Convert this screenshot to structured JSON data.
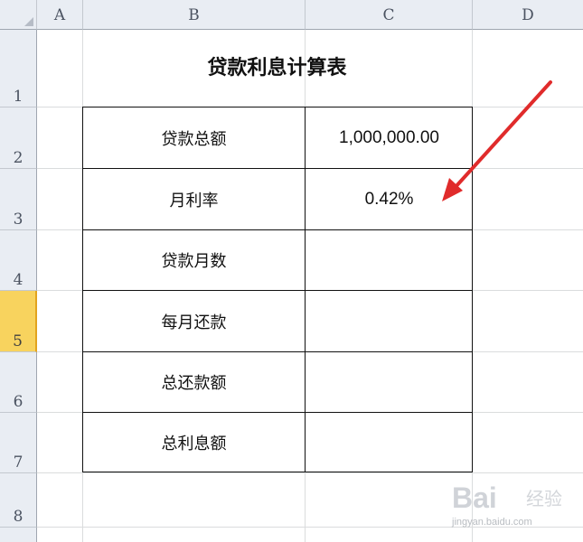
{
  "columns": [
    "A",
    "B",
    "C",
    "D"
  ],
  "rows": [
    "1",
    "2",
    "3",
    "4",
    "5",
    "6",
    "7",
    "8"
  ],
  "selected_row": "5",
  "sheet": {
    "title": "贷款利息计算表",
    "table": [
      {
        "label": "贷款总额",
        "value": "1,000,000.00"
      },
      {
        "label": "月利率",
        "value": "0.42%"
      },
      {
        "label": "贷款月数",
        "value": ""
      },
      {
        "label": "每月还款",
        "value": ""
      },
      {
        "label": "总还款额",
        "value": ""
      },
      {
        "label": "总利息额",
        "value": ""
      }
    ]
  },
  "annotation": {
    "arrow_color": "#e02b2b",
    "arrow_target": "C3"
  },
  "watermark": {
    "logo": "Bai",
    "text": "经验",
    "url": "jingyan.baidu.com"
  }
}
